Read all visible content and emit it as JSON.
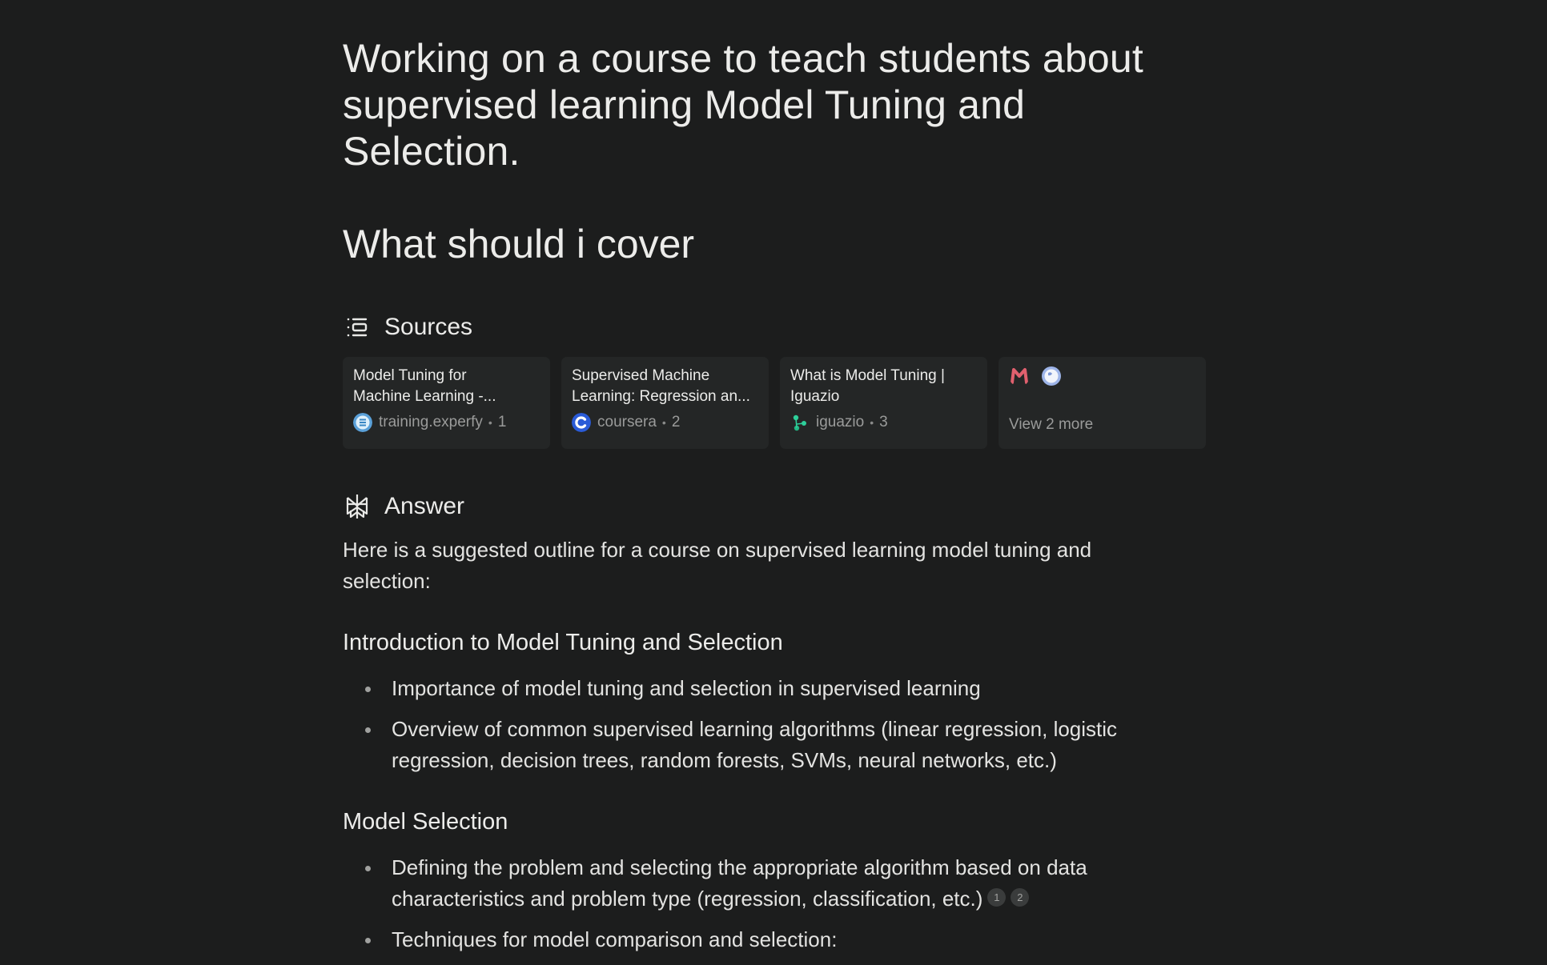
{
  "query": {
    "line1": "Working on a course to teach students about",
    "line2": "supervised learning Model Tuning and",
    "line3": "Selection.",
    "subquery": "What should i cover"
  },
  "sources": {
    "title": "Sources",
    "icon": "sources-list-icon",
    "cards": [
      {
        "title_line1": "Model Tuning for",
        "title_line2": "Machine Learning -...",
        "domain": "training.experfy",
        "index": "1",
        "favicon": "experfy-favicon",
        "favicon_color": "#5aa0d8"
      },
      {
        "title_line1": "Supervised Machine",
        "title_line2": "Learning: Regression an...",
        "domain": "coursera",
        "index": "2",
        "favicon": "coursera-favicon",
        "favicon_color": "#2a5bd7"
      },
      {
        "title_line1": "What is Model Tuning |",
        "title_line2": "Iguazio",
        "domain": "iguazio",
        "index": "3",
        "favicon": "iguazio-favicon",
        "favicon_color": "#2ecf9a"
      }
    ],
    "more": {
      "label": "View 2 more",
      "favicons": [
        "m-logo-favicon",
        "globe-favicon"
      ],
      "favicon_colors": [
        "#e0606e",
        "#9db4e8"
      ]
    }
  },
  "answer": {
    "title": "Answer",
    "icon": "perplexity-logo-icon",
    "intro_line1": "Here is a suggested outline for a course on supervised learning model tuning and",
    "intro_line2": "selection:",
    "sections": [
      {
        "heading": "Introduction to Model Tuning and Selection",
        "bullets": [
          {
            "line1": "Importance of model tuning and selection in supervised learning",
            "line2": ""
          },
          {
            "line1": "Overview of common supervised learning algorithms (linear regression, logistic",
            "line2": "regression, decision trees, random forests, SVMs, neural networks, etc.)"
          }
        ]
      },
      {
        "heading": "Model Selection",
        "bullets": [
          {
            "line1": "Defining the problem and selecting the appropriate algorithm based on data",
            "line2": "characteristics and problem type (regression, classification, etc.)",
            "citations": [
              "1",
              "2"
            ]
          },
          {
            "line1": "Techniques for model comparison and selection:",
            "line2": ""
          }
        ]
      }
    ]
  },
  "colors": {
    "background": "#1c1d1d",
    "card": "#242626",
    "text": "#ececea",
    "muted": "#9a9b9a"
  }
}
